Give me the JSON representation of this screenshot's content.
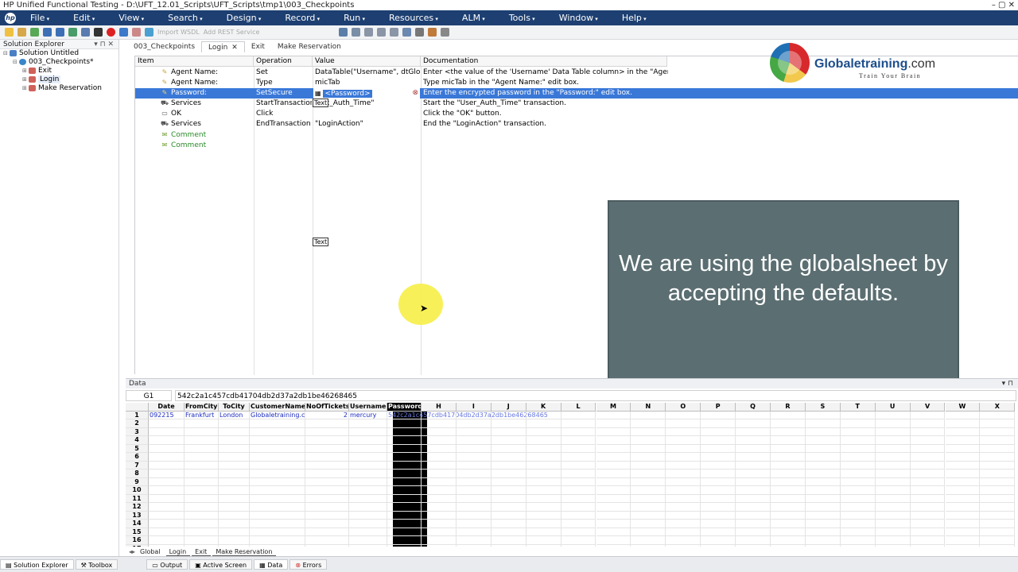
{
  "window": {
    "title": "HP Unified Functional Testing - D:\\UFT_12.01_Scripts\\UFT_Scripts\\tmp1\\003_Checkpoints",
    "controls": "– ▢ ✕"
  },
  "menu": [
    "File",
    "Edit",
    "View",
    "Search",
    "Design",
    "Record",
    "Run",
    "Resources",
    "ALM",
    "Tools",
    "Window",
    "Help"
  ],
  "toolbar": {
    "import_wsdl": "Import WSDL",
    "add_rest": "Add REST Service"
  },
  "solution_explorer": {
    "title": "Solution Explorer",
    "pin": "▾ ⊓ ✕",
    "items": [
      {
        "label": "Solution Untitled",
        "indent": 0
      },
      {
        "label": "003_Checkpoints*",
        "indent": 1
      },
      {
        "label": "Exit",
        "indent": 2
      },
      {
        "label": "Login",
        "indent": 2
      },
      {
        "label": "Make Reservation",
        "indent": 2
      }
    ]
  },
  "doc_tabs": [
    {
      "label": "003_Checkpoints",
      "active": false
    },
    {
      "label": "Login",
      "active": true
    },
    {
      "label": "Exit",
      "active": false
    },
    {
      "label": "Make Reservation",
      "active": false
    }
  ],
  "keyword_view": {
    "columns": [
      "Item",
      "Operation",
      "Value",
      "Documentation"
    ],
    "rows": [
      {
        "item": "Agent Name:",
        "op": "Set",
        "value": "DataTable(\"Username\", dtGloba...",
        "doc": "Enter <the value of the 'Username' Data Table column> in the \"Agent Name:...",
        "icon": "✎",
        "sel": false
      },
      {
        "item": "Agent Name:",
        "op": "Type",
        "value": "micTab",
        "doc": "Type micTab in the \"Agent Name:\" edit box.",
        "icon": "✎",
        "sel": false
      },
      {
        "item": "Password:",
        "op": "SetSecure",
        "value": "<Password>",
        "doc": "Enter the encrypted password in the \"Password:\" edit box.",
        "icon": "✎",
        "sel": true
      },
      {
        "item": "Services",
        "op": "StartTransaction",
        "value": "Text_Auth_Time\"",
        "doc": "Start the \"User_Auth_Time\" transaction.",
        "icon": "⛟",
        "sel": false
      },
      {
        "item": "OK",
        "op": "Click",
        "value": "",
        "doc": "Click the \"OK\" button.",
        "icon": "▭",
        "sel": false
      },
      {
        "item": "Services",
        "op": "EndTransaction",
        "value": "\"LoginAction\"",
        "doc": "End the \"LoginAction\" transaction.",
        "icon": "⛟",
        "sel": false
      },
      {
        "item": "Comment",
        "op": "",
        "value": "",
        "doc": "",
        "icon": "✉",
        "sel": false
      },
      {
        "item": "Comment",
        "op": "",
        "value": "",
        "doc": "",
        "icon": "✉",
        "sel": false
      }
    ],
    "tooltip_text": "Text"
  },
  "logo": {
    "name_main": "Globaletraining",
    "name_suffix": ".com",
    "tagline": "Train Your Brain"
  },
  "caption": "We are using the globalsheet by accepting the defaults.",
  "data_panel": {
    "title": "Data",
    "pin": "▾ ⊓",
    "cell_ref": "G1",
    "cell_value": "542c2a1c457cdb41704db2d37a2db1be46268465",
    "columns": [
      "Date",
      "FromCity",
      "ToCity",
      "CustomerName",
      "NoOfTickets",
      "Username",
      "Password",
      "H",
      "I",
      "J",
      "K",
      "L",
      "M",
      "N",
      "O",
      "P",
      "Q",
      "R",
      "S",
      "T",
      "U",
      "V",
      "W",
      "X"
    ],
    "row1": [
      "092215",
      "Frankfurt",
      "London",
      "Globaletraining.cc",
      "2",
      "mercury",
      "542c2a1c457cdb41704db2d37a2db1be46268465"
    ],
    "row_numbers": [
      "1",
      "2",
      "3",
      "4",
      "5",
      "6",
      "7",
      "8",
      "9",
      "10",
      "11",
      "12",
      "13",
      "14",
      "15",
      "16",
      "17"
    ],
    "sheet_tabs": [
      "Global",
      "Login",
      "Exit",
      "Make Reservation"
    ]
  },
  "bottom_bar": {
    "left": [
      "Solution Explorer",
      "Toolbox"
    ],
    "right": [
      "Output",
      "Active Screen",
      "Data",
      "Errors"
    ]
  },
  "colors": {
    "menu_bg": "#1d3f71",
    "selection": "#3a78d8",
    "caption_bg": "#5b6e72",
    "cursor_highlight": "#f6ef4b"
  }
}
